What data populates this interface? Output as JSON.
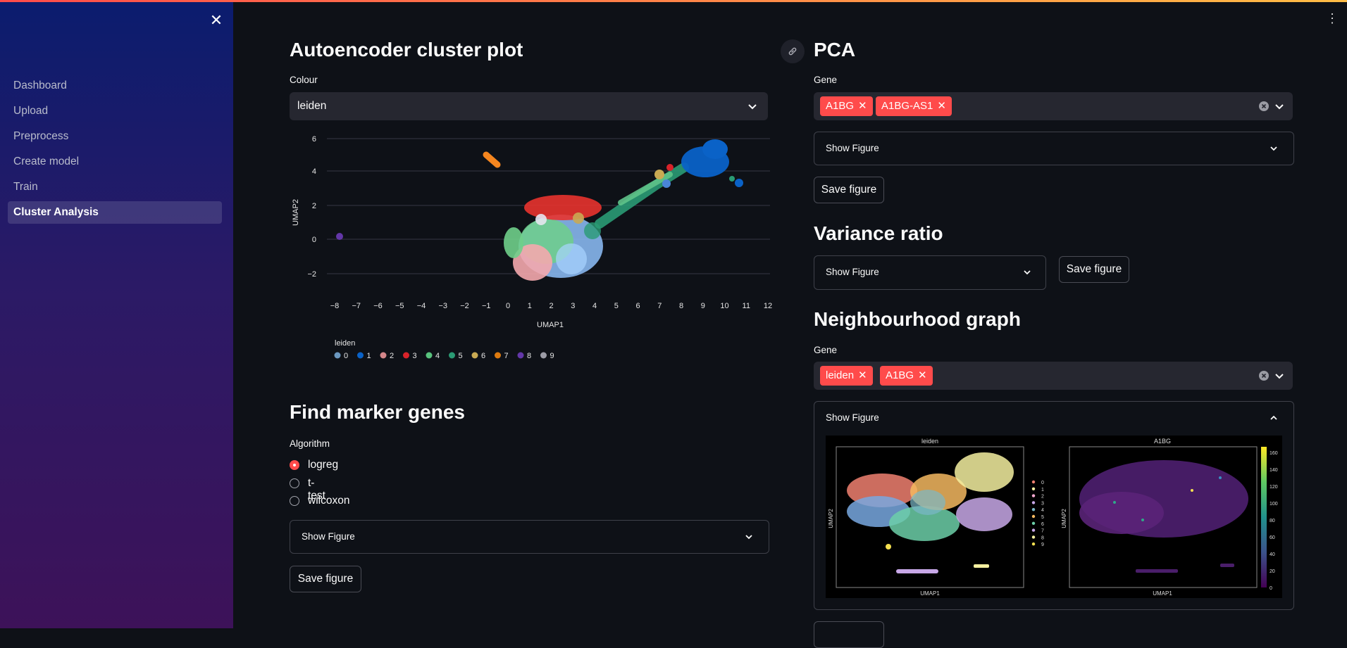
{
  "sidebar": {
    "items": [
      {
        "label": "Dashboard"
      },
      {
        "label": "Upload"
      },
      {
        "label": "Preprocess"
      },
      {
        "label": "Create model"
      },
      {
        "label": "Train"
      },
      {
        "label": "Cluster Analysis"
      }
    ],
    "active_index": 5
  },
  "autoencoder": {
    "title": "Autoencoder cluster plot",
    "colour_label": "Colour",
    "colour_value": "leiden",
    "plot": {
      "xlabel": "UMAP1",
      "ylabel": "UMAP2",
      "x_ticks": [
        "−8",
        "−7",
        "−6",
        "−5",
        "−4",
        "−3",
        "−2",
        "−1",
        "0",
        "1",
        "2",
        "3",
        "4",
        "5",
        "6",
        "7",
        "8",
        "9",
        "10",
        "11",
        "12"
      ],
      "y_ticks": [
        "6",
        "4",
        "2",
        "0",
        "−2"
      ],
      "legend_title": "leiden",
      "legend": [
        {
          "label": "0",
          "color": "#6b98c0"
        },
        {
          "label": "1",
          "color": "#0a62c7"
        },
        {
          "label": "2",
          "color": "#d4868a"
        },
        {
          "label": "3",
          "color": "#d8232a"
        },
        {
          "label": "4",
          "color": "#58c27d"
        },
        {
          "label": "5",
          "color": "#2a9b74"
        },
        {
          "label": "6",
          "color": "#c9aa53"
        },
        {
          "label": "7",
          "color": "#dd7a0f"
        },
        {
          "label": "8",
          "color": "#6337a8"
        },
        {
          "label": "9",
          "color": "#9c9ca6"
        }
      ]
    }
  },
  "marker_genes": {
    "title": "Find marker genes",
    "algorithm_label": "Algorithm",
    "options": [
      "logreg",
      "t-test",
      "wilcoxon"
    ],
    "selected": "logreg",
    "expander_label": "Show Figure",
    "save_label": "Save figure"
  },
  "pca": {
    "title": "PCA",
    "gene_label": "Gene",
    "tags": [
      "A1BG",
      "A1BG-AS1"
    ],
    "expander_label": "Show Figure",
    "save_label": "Save figure"
  },
  "variance": {
    "title": "Variance ratio",
    "expander_label": "Show Figure",
    "save_label": "Save figure"
  },
  "neighbourhood": {
    "title": "Neighbourhood graph",
    "gene_label": "Gene",
    "tags": [
      "leiden",
      "A1BG"
    ],
    "expander_label": "Show Figure",
    "fig_left_title": "leiden",
    "fig_right_title": "A1BG",
    "fig_xlabel": "UMAP1",
    "fig_ylabel": "UMAP2",
    "fig_legend": [
      "0",
      "1",
      "2",
      "3",
      "4",
      "5",
      "6",
      "7",
      "8",
      "9"
    ],
    "colorbar_ticks": [
      "160",
      "140",
      "120",
      "100",
      "80",
      "60",
      "40",
      "20",
      "0"
    ]
  },
  "colors": {
    "accent": "#ff4b4b",
    "background": "#0e1117",
    "input_bg": "#262730"
  },
  "icons": {
    "close": "close-icon",
    "menu": "kebab-menu-icon",
    "link": "link-icon",
    "chevron": "chevron-down-icon"
  }
}
